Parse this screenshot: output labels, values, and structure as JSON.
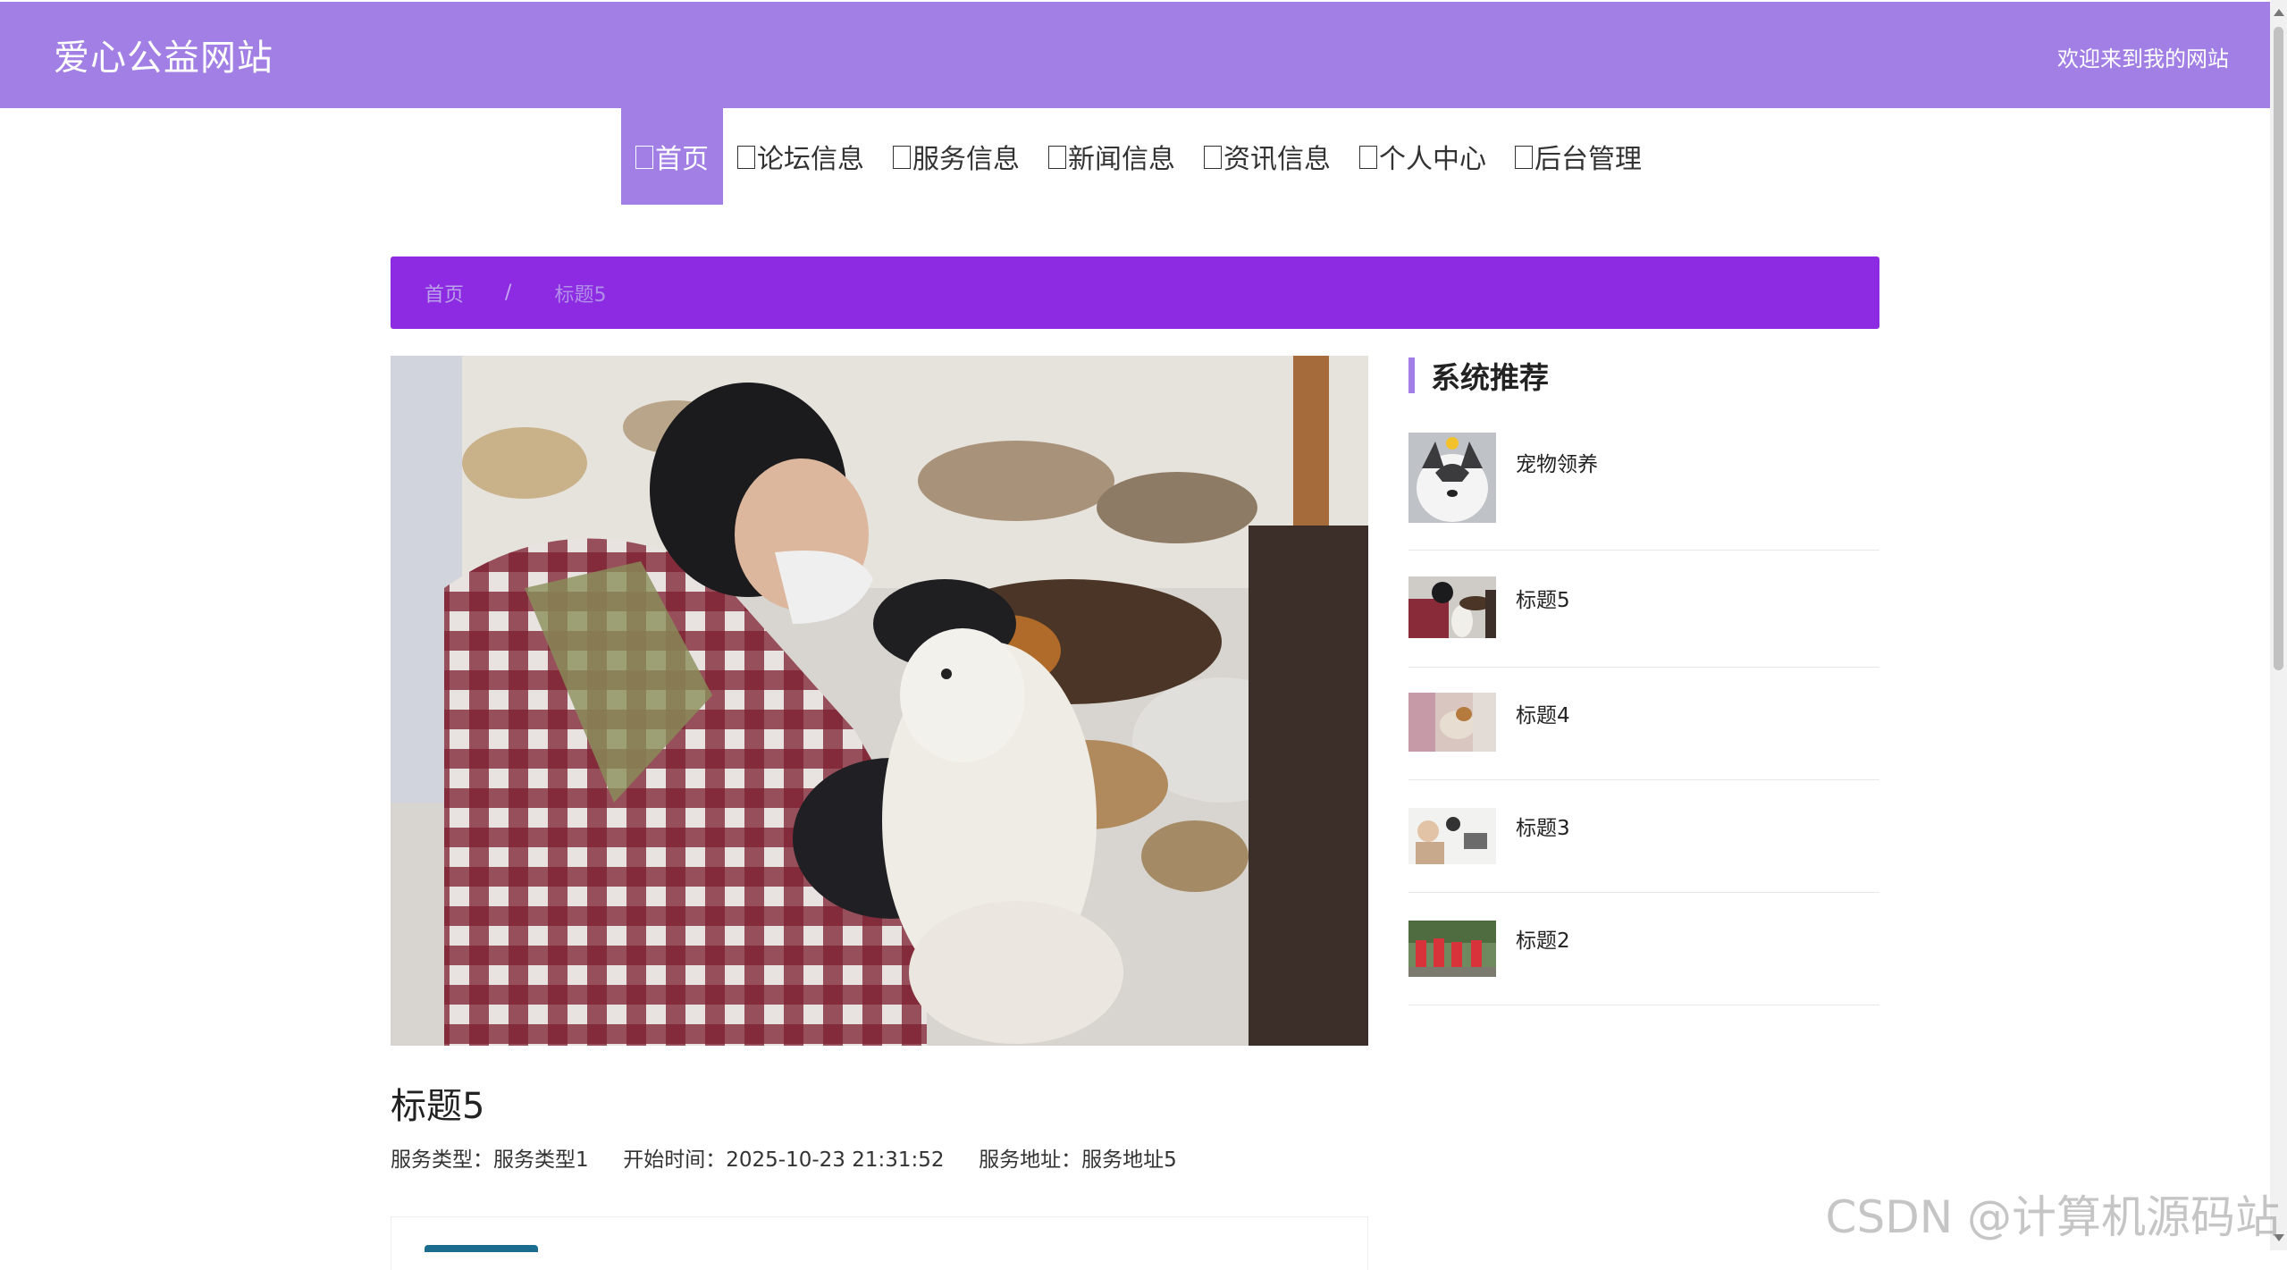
{
  "header": {
    "site_title": "爱心公益网站",
    "welcome": "欢迎来到我的网站"
  },
  "nav": {
    "items": [
      {
        "label": "首页",
        "active": true
      },
      {
        "label": "论坛信息"
      },
      {
        "label": "服务信息"
      },
      {
        "label": "新闻信息"
      },
      {
        "label": "资讯信息"
      },
      {
        "label": "个人中心"
      },
      {
        "label": "后台管理"
      }
    ]
  },
  "breadcrumb": {
    "home": "首页",
    "separator": "/",
    "current": "标题5"
  },
  "detail": {
    "title": "标题5",
    "service_type_label": "服务类型：",
    "service_type": "服务类型1",
    "start_time_label": "开始时间：",
    "start_time": "2025-10-23 21:31:52",
    "address_label": "服务地址：",
    "address": "服务地址5"
  },
  "sidebar": {
    "title": "系统推荐",
    "items": [
      {
        "label": "宠物领养"
      },
      {
        "label": "标题5"
      },
      {
        "label": "标题4"
      },
      {
        "label": "标题3"
      },
      {
        "label": "标题2"
      }
    ]
  },
  "watermark": "CSDN @计算机源码站",
  "colors": {
    "header_bg": "#a17fe4",
    "breadcrumb_bg": "#8c2be2",
    "accent": "#a17fe4"
  }
}
